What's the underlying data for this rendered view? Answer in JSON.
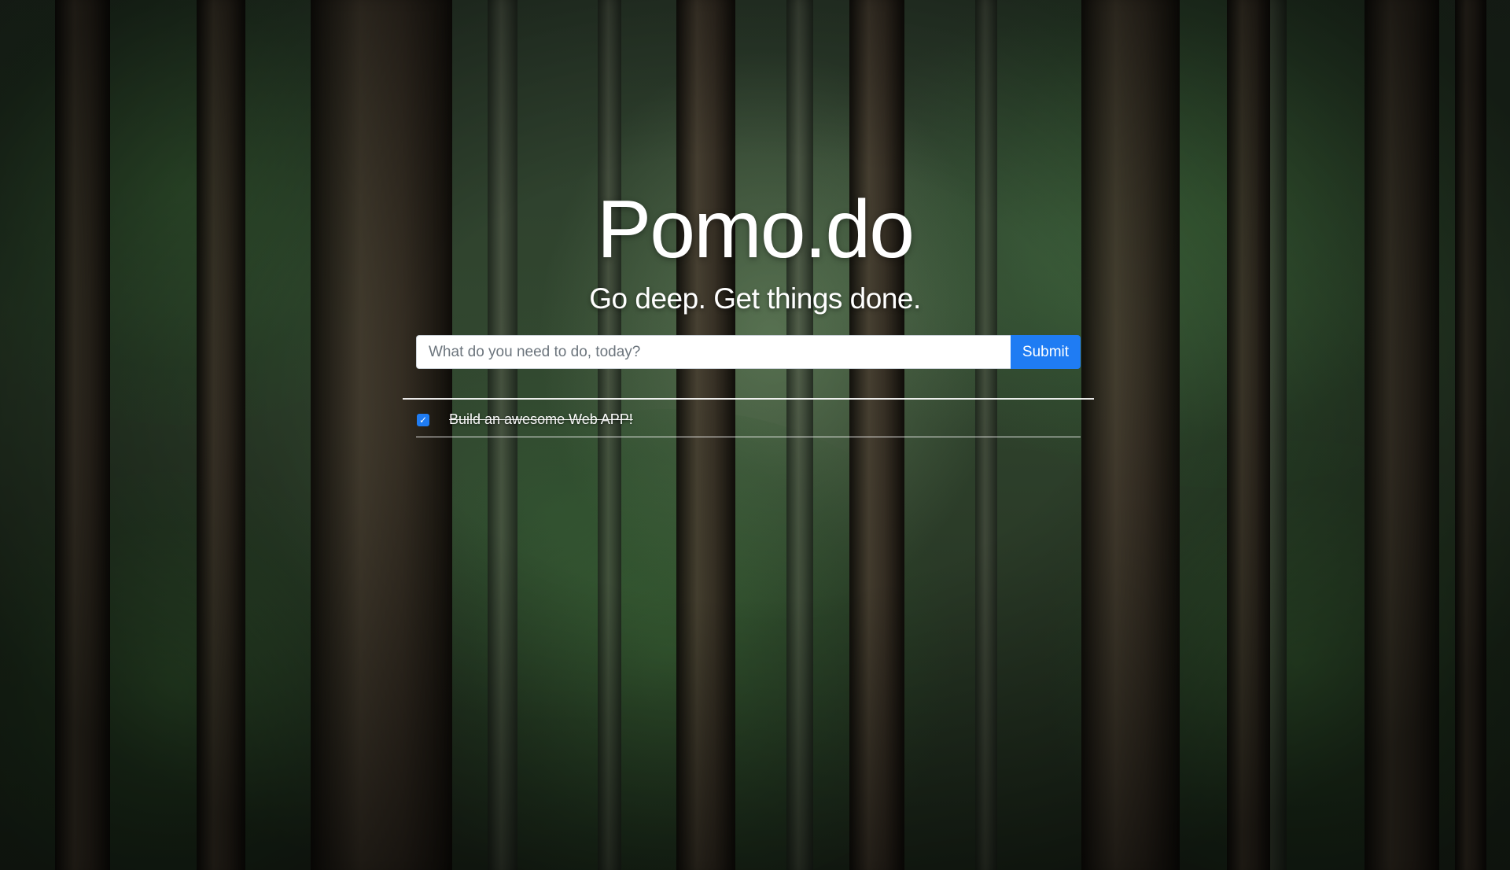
{
  "app": {
    "title": "Pomo.do",
    "tagline": "Go deep. Get things done."
  },
  "task_form": {
    "input_value": "",
    "input_placeholder": "What do you need to do, today?",
    "submit_label": "Submit"
  },
  "todos": [
    {
      "text": "Build an awesome Web APP!",
      "completed": true,
      "check_icon": "✓"
    }
  ],
  "colors": {
    "accent": "#1f7cf3",
    "text": "#ffffff",
    "background_theme": "#2b3a2b"
  },
  "background": {
    "image": "forest-icon"
  }
}
